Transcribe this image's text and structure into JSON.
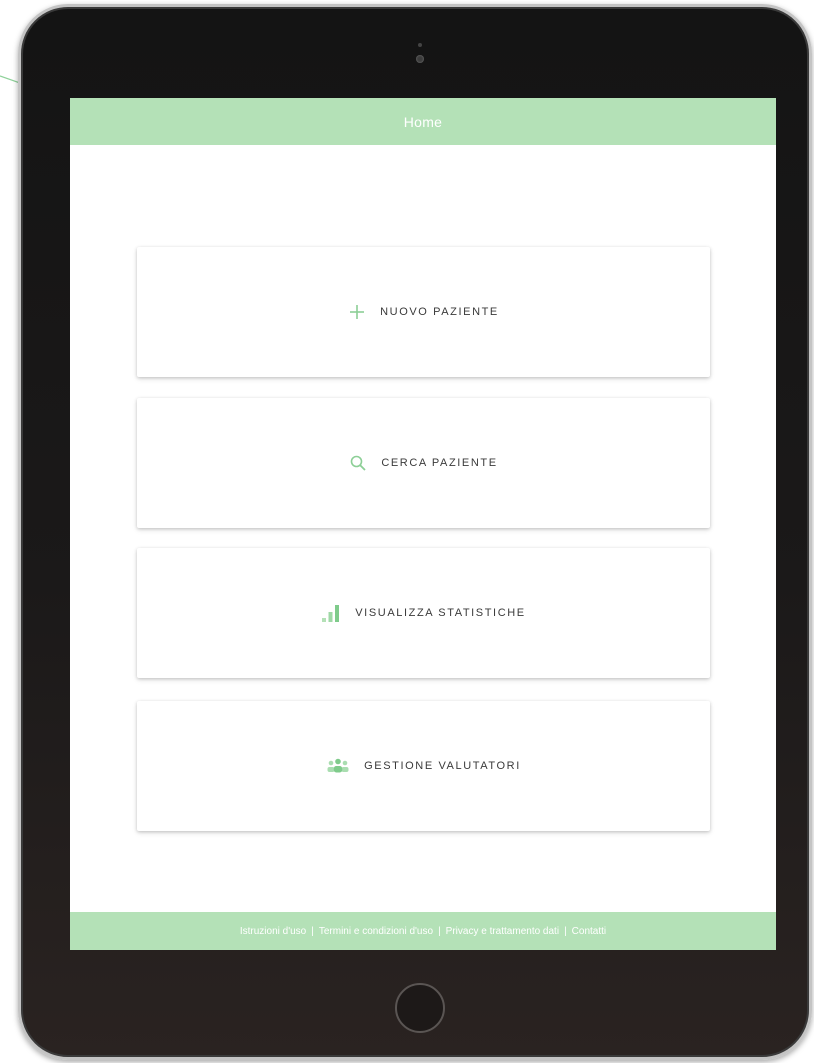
{
  "header": {
    "title": "Home"
  },
  "menu": [
    {
      "label": "NUOVO PAZIENTE",
      "icon": "plus-icon"
    },
    {
      "label": "CERCA PAZIENTE",
      "icon": "search-icon"
    },
    {
      "label": "VISUALIZZA STATISTICHE",
      "icon": "bar-chart-icon"
    },
    {
      "label": "GESTIONE VALUTATORI",
      "icon": "people-group-icon"
    }
  ],
  "footer": {
    "links": [
      "Istruzioni d'uso",
      "Termini e condizioni d'uso",
      "Privacy e trattamento dati",
      "Contatti"
    ],
    "separator": "|"
  },
  "colors": {
    "accent": "#b4e1b7",
    "icon": "#8ccf96",
    "device_frame": "#141414"
  }
}
